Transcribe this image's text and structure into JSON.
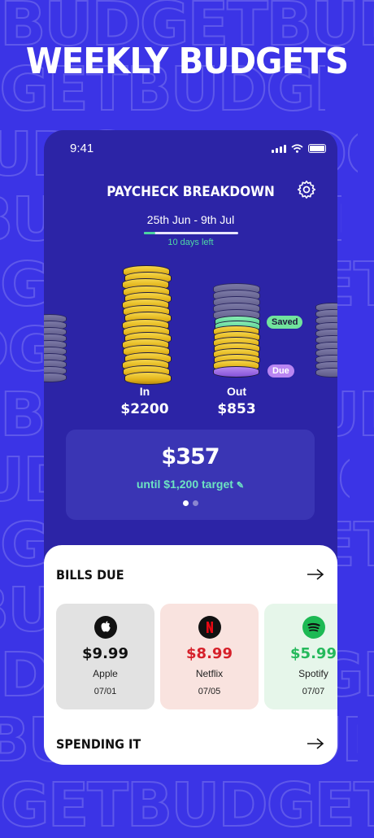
{
  "background": {
    "color": "#3b34e6",
    "pattern_word": "BUDGET"
  },
  "headline": "WEEKLY BUDGETS",
  "status_bar": {
    "time": "9:41"
  },
  "header": {
    "title": "PAYCHECK BREAKDOWN",
    "settings_icon": "gear-icon"
  },
  "period": {
    "range": "25th Jun - 9th Jul",
    "days_left": "10 days left",
    "progress_fraction": 0.12
  },
  "columns": {
    "in": {
      "label": "In",
      "amount": "$2200"
    },
    "out": {
      "label": "Out",
      "amount": "$853"
    }
  },
  "legend": {
    "saved": "Saved",
    "due": "Due"
  },
  "summary": {
    "amount": "$357",
    "target": "until $1,200 target",
    "edit_icon": "edit-icon",
    "page": 1,
    "pages": 2
  },
  "bills": {
    "title": "BILLS DUE",
    "items": [
      {
        "name": "Apple",
        "price": "$9.99",
        "date": "07/01",
        "icon": "apple-icon",
        "bg": "#e2e2e2",
        "price_color": "#111111"
      },
      {
        "name": "Netflix",
        "price": "$8.99",
        "date": "07/05",
        "icon": "netflix-icon",
        "bg": "#f9e3df",
        "price_color": "#d6202a"
      },
      {
        "name": "Spotify",
        "price": "$5.99",
        "date": "07/07",
        "icon": "spotify-icon",
        "bg": "#e6f6ea",
        "price_color": "#25b95c"
      }
    ]
  },
  "spending": {
    "title": "SPENDING IT"
  },
  "colors": {
    "accent": "#3b34e6",
    "phone_bg": "#2c24a6",
    "progress": "#4cd4a0",
    "saved": "#71e39d",
    "due": "#b985f2"
  }
}
